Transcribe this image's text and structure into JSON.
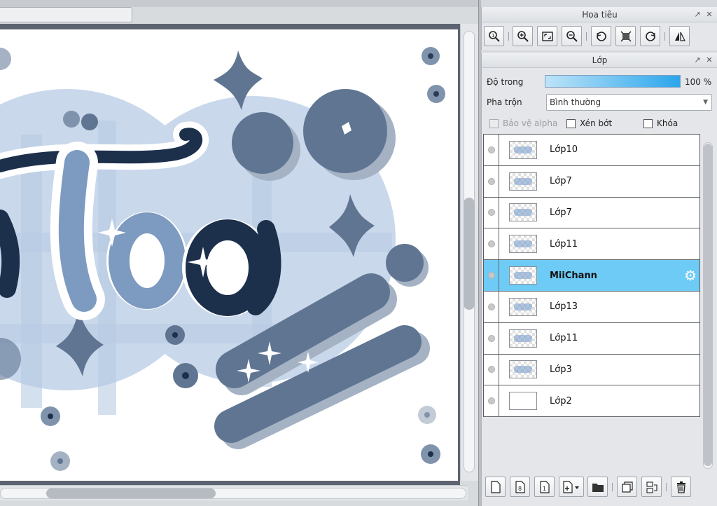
{
  "navigator": {
    "title": "Hoa tiêu",
    "tools": [
      "actual-size-icon",
      "zoom-in-icon",
      "fit-window-icon",
      "zoom-out-icon",
      "rotate-left-icon",
      "reset-view-icon",
      "rotate-right-icon",
      "flip-horizontal-icon"
    ]
  },
  "layers_panel": {
    "title": "Lớp",
    "opacity_label": "Độ trong",
    "opacity_value": "100 %",
    "opacity_fraction": 1.0,
    "blend_label": "Pha trộn",
    "blend_value": "Bình thường",
    "protect_alpha_label": "Bảo vệ alpha",
    "clipping_label": "Xén bớt",
    "lock_label": "Khóa",
    "layers": [
      {
        "name": "Lớp10",
        "selected": false
      },
      {
        "name": "Lớp7",
        "selected": false
      },
      {
        "name": "Lớp7",
        "selected": false
      },
      {
        "name": "Lớp11",
        "selected": false
      },
      {
        "name": "MiiChann",
        "selected": true
      },
      {
        "name": "Lớp13",
        "selected": false
      },
      {
        "name": "Lớp11",
        "selected": false
      },
      {
        "name": "Lớp3",
        "selected": false
      },
      {
        "name": "Lớp2",
        "selected": false
      }
    ],
    "toolbar_icons": [
      "new-layer-icon",
      "new-8bit-layer-icon",
      "new-1bit-layer-icon",
      "add-layer-menu-icon",
      "new-folder-icon",
      "duplicate-layer-icon",
      "merge-down-icon",
      "delete-layer-icon"
    ]
  },
  "colors": {
    "selected_layer": "#6ecbf5",
    "art_dark": "#1c2f4b",
    "art_mid": "#5f7592",
    "art_light": "#c9d8eb"
  }
}
